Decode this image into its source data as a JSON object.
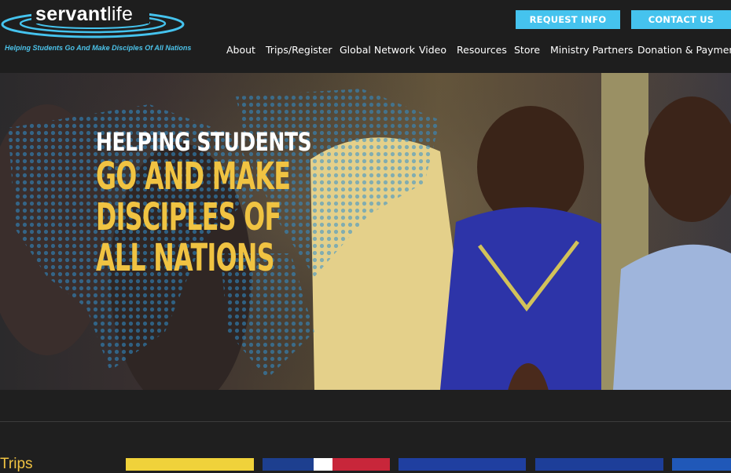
{
  "brand": {
    "name_bold": "servant",
    "name_light": "life",
    "tagline": "Helping Students Go And Make Disciples Of All Nations"
  },
  "header_buttons": {
    "request_info": "REQUEST INFO",
    "contact_us": "CONTACT US"
  },
  "nav": [
    "About",
    "Trips/Register",
    "Global Network",
    "Video",
    "Resources",
    "Store",
    "Ministry Partners",
    "Donation & Payments"
  ],
  "hero": {
    "line1": "HELPING STUDENTS",
    "line2": "GO AND MAKE",
    "line3": "DISCIPLES OF",
    "line4": "ALL NATIONS"
  },
  "section": {
    "trips_label": "Trips"
  },
  "colors": {
    "accent": "#45c3ee",
    "headline_yellow": "#f0c342",
    "background": "#1f1f1f"
  }
}
